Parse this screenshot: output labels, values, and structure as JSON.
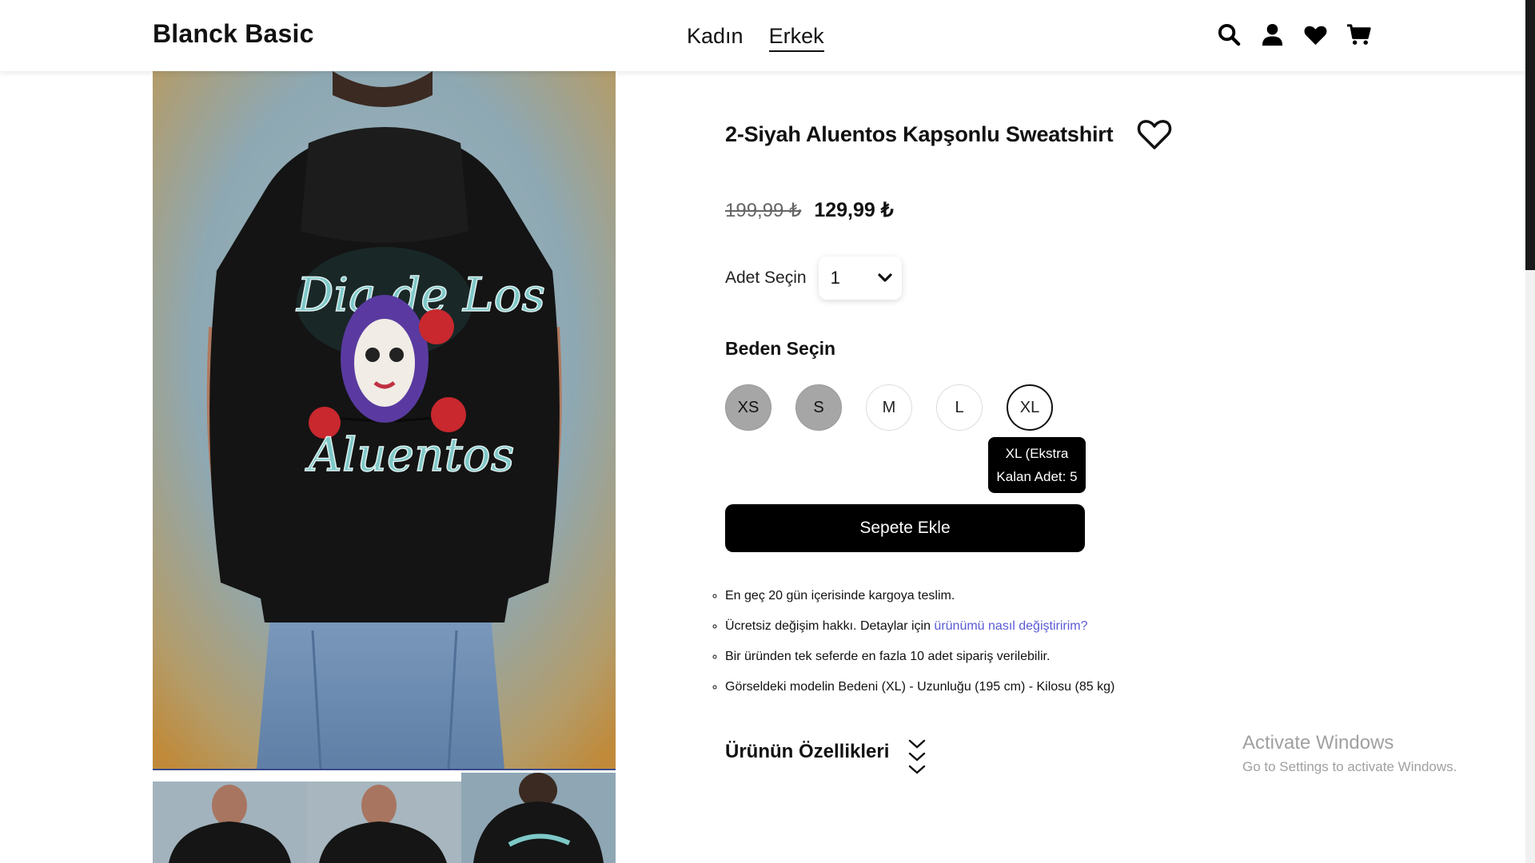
{
  "header": {
    "logo": "Blanck Basic",
    "nav": [
      {
        "label": "Kadın",
        "active": false
      },
      {
        "label": "Erkek",
        "active": true
      }
    ],
    "icons": [
      "search-icon",
      "user-icon",
      "heart-icon",
      "cart-icon"
    ]
  },
  "product": {
    "title": "2-Siyah Aluentos Kapşonlu Sweatshirt",
    "old_price": "199,99 ₺",
    "new_price": "129,99 ₺",
    "quantity_label": "Adet Seçin",
    "quantity_value": "1",
    "size_title": "Beden Seçin",
    "sizes": [
      {
        "label": "XS",
        "state": "out"
      },
      {
        "label": "S",
        "state": "out"
      },
      {
        "label": "M",
        "state": "available"
      },
      {
        "label": "L",
        "state": "available"
      },
      {
        "label": "XL",
        "state": "selected"
      }
    ],
    "tooltip": {
      "line1": "XL (Ekstra",
      "line2": "Kalan Adet: 5"
    },
    "add_to_cart": "Sepete Ekle",
    "info": {
      "item1": "En geç 20 gün içerisinde kargoya teslim.",
      "item2_text": "Ücretsiz değişim hakkı. Detaylar için ",
      "item2_link": "ürünümü nasıl değiştiririm?",
      "item3": "Bir üründen tek seferde en fazla 10 adet sipariş verilebilir.",
      "item4": "Görseldeki modelin Bedeni (XL) - Uzunluğu (195 cm) - Kilosu (85 kg)"
    },
    "features_title": "Ürünün Özellikleri"
  },
  "watermark": {
    "line1": "Activate Windows",
    "line2": "Go to Settings to activate Windows."
  },
  "colors": {
    "accent": "#000000",
    "link": "#5a5ad6",
    "out_of_stock": "#a6a6a6"
  }
}
